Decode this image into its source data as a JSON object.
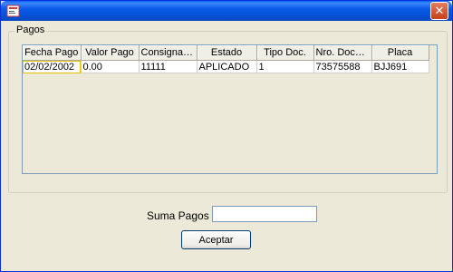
{
  "window": {
    "title": "",
    "close_glyph": "✕"
  },
  "group": {
    "label": "Pagos"
  },
  "table": {
    "columns": [
      "Fecha Pago",
      "Valor Pago",
      "Consignación",
      "Estado",
      "Tipo Doc.",
      "Nro. Docum...",
      "Placa"
    ],
    "rows": [
      [
        "02/02/2002",
        "0.00",
        "11111",
        "APLICADO",
        "1",
        "73575588",
        "BJJ691"
      ]
    ]
  },
  "suma": {
    "label": "Suma Pagos",
    "value": ""
  },
  "buttons": {
    "accept": "Aceptar"
  }
}
